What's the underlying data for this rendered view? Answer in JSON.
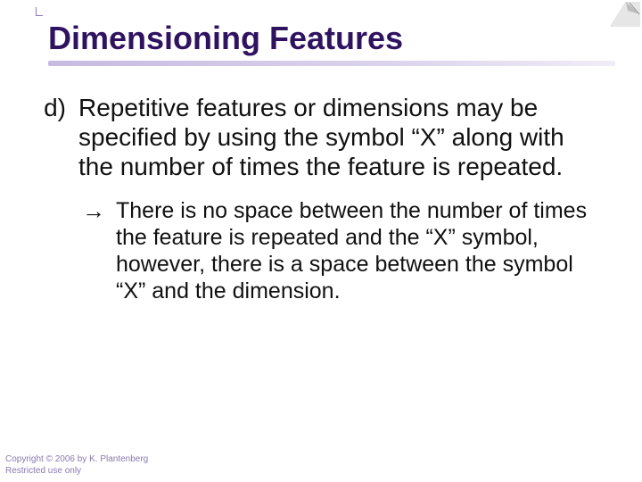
{
  "title": "Dimensioning Features",
  "body": {
    "marker_d": "d)",
    "text_d": "Repetitive features or dimensions may be specified by using the symbol “X” along with the number of times the feature is repeated.",
    "marker_arrow": "→",
    "text_arrow": "There is no space between the number of times the feature is repeated and the “X” symbol, however, there is a space between the symbol “X” and the dimension."
  },
  "footer": {
    "line1": "Copyright © 2006 by K. Plantenberg",
    "line2": "Restricted use only"
  }
}
